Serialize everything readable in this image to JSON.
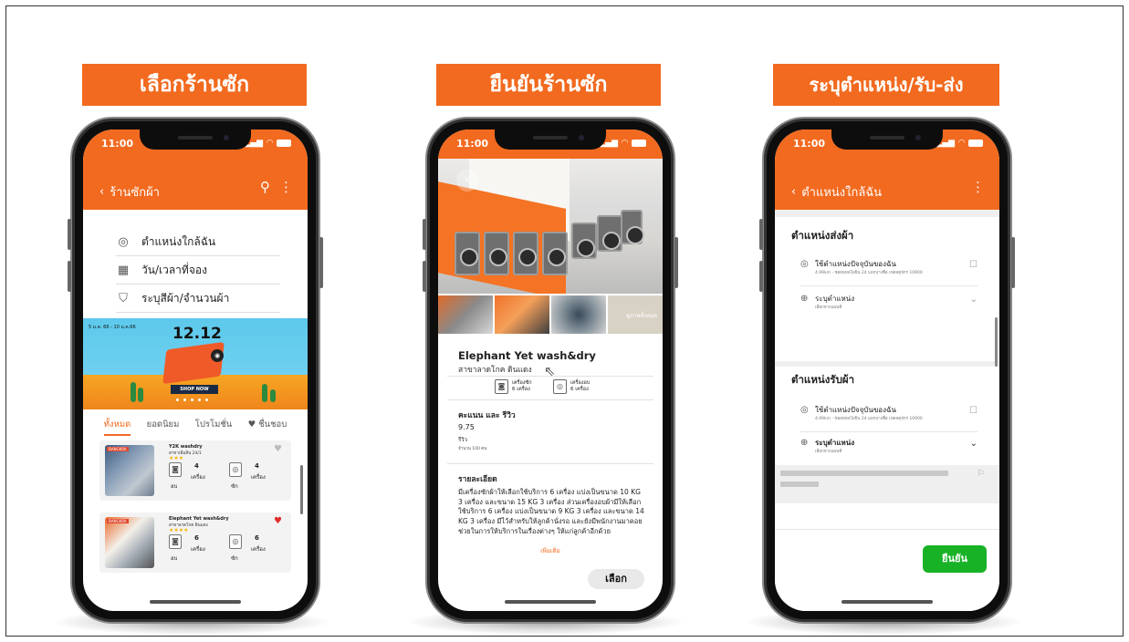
{
  "panels": [
    {
      "banner": "เลือกร้านซัก",
      "time": "11:00",
      "header_title": "ร้านซักผ้า"
    },
    {
      "banner": "ยืนยันร้านซัก",
      "time": "11:00"
    },
    {
      "banner": "ระบุตำแหน่ง/รับ-ส่ง",
      "time": "11:00",
      "header_title": "ตำแหน่งใกล้ฉัน"
    }
  ],
  "screen1": {
    "options": [
      {
        "icon": "location-pin-icon",
        "label": "ตำแหน่งใกล้ฉัน"
      },
      {
        "icon": "calendar-icon",
        "label": "วัน/เวลาที่จอง"
      },
      {
        "icon": "shirt-icon",
        "label": "ระบุสีผ้า/จำนวนผ้า"
      }
    ],
    "promo": {
      "date": "5 ม.ค. 66 - 10 ม.ค.66",
      "title": "12.12",
      "cta": "SHOP NOW"
    },
    "tabs": [
      "ทั้งหมด",
      "ยอดนิยม",
      "โปรโมชั่น",
      "♥ ชื่นชอบ"
    ],
    "shops": [
      {
        "tag": "BANGKOK",
        "name": "Y2K washdry",
        "branch": "สาขาเพิ่มสิน 24/1",
        "stars": "★★★",
        "dry_count": "4",
        "wash_count": "4",
        "unit": "เครื่อง",
        "dry_label": "อบ",
        "wash_label": "ซัก",
        "heart": "♥",
        "favorite": false
      },
      {
        "tag": "BANGKOK",
        "name": "Elephant Yet wash&dry",
        "branch": "สาขาลาดโกค ดินแดง",
        "stars": "★★★★",
        "dry_count": "6",
        "wash_count": "6",
        "unit": "เครื่อง",
        "dry_label": "อบ",
        "wash_label": "ซัก",
        "heart": "♥",
        "favorite": true
      }
    ]
  },
  "screen2": {
    "gallery_label": "ดูภาพทั้งหมด",
    "shop_name": "Elephant Yet wash&dry",
    "shop_branch": "สาขาลาดโกค ดินแดง",
    "machines": [
      {
        "label": "เครื่องซัก",
        "count": "6 เครื่อง"
      },
      {
        "label": "เครื่องอบ",
        "count": "6 เครื่อง"
      }
    ],
    "rating_heading": "คะแนน และ รีวิว",
    "rating_score": "9.75",
    "review_label": "รีวิว",
    "review_count": "จำนวน 100 คน",
    "detail_heading": "รายละเอียด",
    "detail_text": "มีเครื่องซักผ้าให้เลือกใช้บริการ 6 เครื่อง แบ่งเป็นขนาด 10 KG 3 เครื่อง และขนาด 15 KG 3 เครื่อง ส่วนเครื่องอบผ้ามีให้เลือกใช้บริการ 6 เครื่อง แบ่งเป็นขนาด 9 KG 3 เครื่อง และขนาด 14 KG 3 เครื่อง มีไว้สำหรับให้ลูกค้านั่งรอ และยังมีพนักงานมาคอยช่วยในการให้บริการในเรื่องต่างๆ ให้แก่ลูกค้าอีกด้วย",
    "more": "เพิ่มเติม",
    "select_button": "เลือก"
  },
  "screen3": {
    "delivery_heading": "ตำแหน่งส่งผ้า",
    "pickup_heading": "ตำแหน่งรับผ้า",
    "current_location": "ใช้ตำแหน่งปัจจุบันของฉัน",
    "current_location_sub": "4.99km - ซอยพหลโยธิน 24 แยกบางซื่อ เขตจตุจักร 10900",
    "specify_location": "ระบุตำแหน่ง",
    "specify_location_sub": "เลือกจากแผนที่",
    "confirm_button": "ยืนยัน"
  }
}
